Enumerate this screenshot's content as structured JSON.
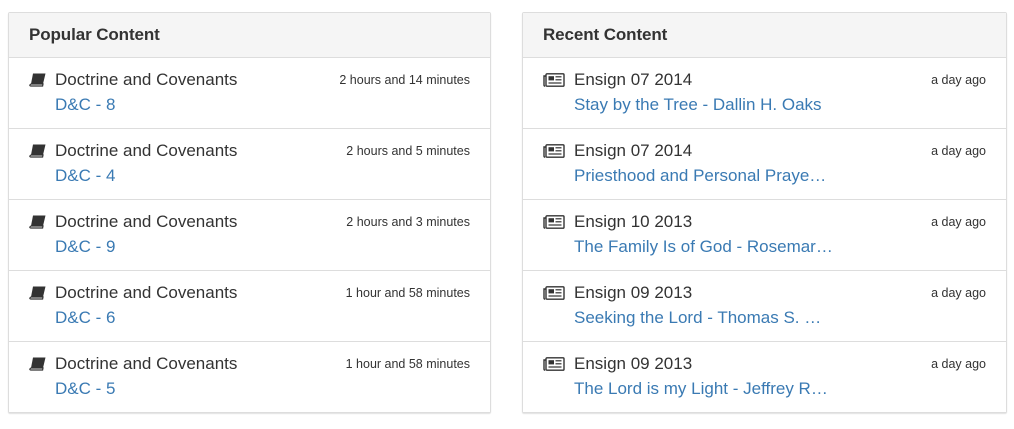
{
  "popular": {
    "title": "Popular Content",
    "items": [
      {
        "icon": "book-icon",
        "title": "Doctrine and Covenants",
        "link": "D&C - 8",
        "time": "2 hours and 14 minutes"
      },
      {
        "icon": "book-icon",
        "title": "Doctrine and Covenants",
        "link": "D&C - 4",
        "time": "2 hours and 5 minutes"
      },
      {
        "icon": "book-icon",
        "title": "Doctrine and Covenants",
        "link": "D&C - 9",
        "time": "2 hours and 3 minutes"
      },
      {
        "icon": "book-icon",
        "title": "Doctrine and Covenants",
        "link": "D&C - 6",
        "time": "1 hour and 58 minutes"
      },
      {
        "icon": "book-icon",
        "title": "Doctrine and Covenants",
        "link": "D&C - 5",
        "time": "1 hour and 58 minutes"
      }
    ]
  },
  "recent": {
    "title": "Recent Content",
    "items": [
      {
        "icon": "newspaper-icon",
        "title": "Ensign 07 2014",
        "link": "Stay by the Tree - Dallin H. Oaks",
        "time": "a day ago"
      },
      {
        "icon": "newspaper-icon",
        "title": "Ensign 07 2014",
        "link": "Priesthood and Personal Praye…",
        "time": "a day ago"
      },
      {
        "icon": "newspaper-icon",
        "title": "Ensign 10 2013",
        "link": "The Family Is of God - Rosemar…",
        "time": "a day ago"
      },
      {
        "icon": "newspaper-icon",
        "title": "Ensign 09 2013",
        "link": "Seeking the Lord - Thomas S. …",
        "time": "a day ago"
      },
      {
        "icon": "newspaper-icon",
        "title": "Ensign 09 2013",
        "link": "The Lord is my Light - Jeffrey R…",
        "time": "a day ago"
      }
    ]
  },
  "colors": {
    "link": "#3a7ab3",
    "text": "#333333",
    "heading_bg": "#f5f5f5",
    "border": "#dddddd"
  }
}
